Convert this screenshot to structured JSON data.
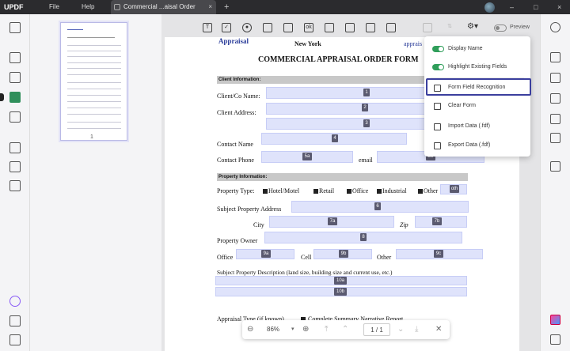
{
  "app": {
    "logo": "UPDF",
    "menu": [
      "File",
      "Help"
    ],
    "tab_title": "Commercial ...aisal Order",
    "tab_close": "×",
    "new_tab": "+",
    "window_controls": [
      "–",
      "□",
      "×"
    ]
  },
  "toolbar": {
    "preview_label": "Preview",
    "icons": [
      "text-field-icon",
      "checkbox-icon",
      "radio-button-icon",
      "dropdown-icon",
      "list-box-icon",
      "button-icon",
      "image-field-icon",
      "signature-field-icon",
      "date-field-icon",
      "more-icon",
      "align-icon",
      "form-tools-icon"
    ]
  },
  "dropdown": {
    "display_name": "Display Name",
    "highlight_fields": "Highlight Existing Fields",
    "form_field_recognition": "Form Field Recognition",
    "clear_form": "Clear Form",
    "import_data": "Import Data (.fdf)",
    "export_data": "Export Data (.fdf)"
  },
  "thumbnail": {
    "page_number": "1"
  },
  "document": {
    "top_left": "Appraisal",
    "top_city": "New York",
    "top_right": "apprais",
    "title": "COMMERCIAL APPRAISAL ORDER FORM",
    "client_section": "Client Information:",
    "client_name": "Client/Co Name:",
    "client_address": "Client Address:",
    "contact_name": "Contact Name",
    "contact_phone": "Contact Phone",
    "email": "email",
    "property_section": "Property Information:",
    "property_type": "Property Type:",
    "types": [
      "Hotel/Motel",
      "Retail",
      "Office",
      "Industrial",
      "Other"
    ],
    "subject_address": "Subject Property Address",
    "city": "City",
    "zip": "Zip",
    "property_owner": "Property Owner",
    "office": "Office",
    "cell": "Cell",
    "other": "Other",
    "subject_description": "Subject Property Description (land size, building size and current use, etc.)",
    "appraisal_type": "Appraisal Type (if known)",
    "complete_summary": "Complete Summary Narrative Report",
    "tags": {
      "f1": "1",
      "f2": "2",
      "f3": "3",
      "f4": "4",
      "f5a": "5a",
      "f5b": "5b",
      "f6": "6",
      "f7a": "7a",
      "f7b": "7b",
      "f8": "8",
      "f9a": "9a",
      "f9b": "9b",
      "f9c": "9c",
      "f10a": "10a",
      "f10b": "10b",
      "fother": "oth"
    }
  },
  "bottom": {
    "zoom": "86%",
    "page": "1 / 1",
    "zoom_out": "⊖",
    "zoom_in": "⊕",
    "caret": "▾"
  }
}
